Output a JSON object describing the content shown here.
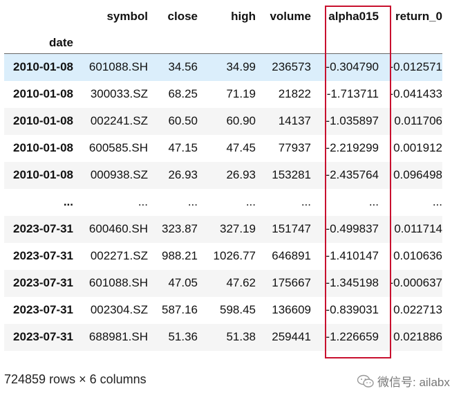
{
  "table": {
    "columns": [
      "symbol",
      "close",
      "high",
      "volume",
      "alpha015",
      "return_0"
    ],
    "index_name": "date",
    "rows": [
      {
        "date": "2010-01-08",
        "symbol": "601088.SH",
        "close": "34.56",
        "high": "34.99",
        "volume": "236573",
        "alpha015": "-0.304790",
        "return_0": "-0.012571"
      },
      {
        "date": "2010-01-08",
        "symbol": "300033.SZ",
        "close": "68.25",
        "high": "71.19",
        "volume": "21822",
        "alpha015": "-1.713711",
        "return_0": "-0.041433"
      },
      {
        "date": "2010-01-08",
        "symbol": "002241.SZ",
        "close": "60.50",
        "high": "60.90",
        "volume": "14137",
        "alpha015": "-1.035897",
        "return_0": "0.011706"
      },
      {
        "date": "2010-01-08",
        "symbol": "600585.SH",
        "close": "47.15",
        "high": "47.45",
        "volume": "77937",
        "alpha015": "-2.219299",
        "return_0": "0.001912"
      },
      {
        "date": "2010-01-08",
        "symbol": "000938.SZ",
        "close": "26.93",
        "high": "26.93",
        "volume": "153281",
        "alpha015": "-2.435764",
        "return_0": "0.096498"
      },
      {
        "date": "...",
        "symbol": "...",
        "close": "...",
        "high": "...",
        "volume": "...",
        "alpha015": "...",
        "return_0": "..."
      },
      {
        "date": "2023-07-31",
        "symbol": "600460.SH",
        "close": "323.87",
        "high": "327.19",
        "volume": "151747",
        "alpha015": "-0.499837",
        "return_0": "0.011714"
      },
      {
        "date": "2023-07-31",
        "symbol": "002271.SZ",
        "close": "988.21",
        "high": "1026.77",
        "volume": "646891",
        "alpha015": "-1.410147",
        "return_0": "0.010636"
      },
      {
        "date": "2023-07-31",
        "symbol": "601088.SH",
        "close": "47.05",
        "high": "47.62",
        "volume": "175667",
        "alpha015": "-1.345198",
        "return_0": "-0.000637"
      },
      {
        "date": "2023-07-31",
        "symbol": "002304.SZ",
        "close": "587.16",
        "high": "598.45",
        "volume": "136609",
        "alpha015": "-0.839031",
        "return_0": "0.022713"
      },
      {
        "date": "2023-07-31",
        "symbol": "688981.SH",
        "close": "51.36",
        "high": "51.38",
        "volume": "259441",
        "alpha015": "-1.226659",
        "return_0": "0.021886"
      }
    ]
  },
  "shape_text": "724859 rows × 6 columns",
  "watermark": {
    "text": "微信号: ailabx",
    "icon": "wechat-icon"
  },
  "colors": {
    "highlight_row": "#dbeefb",
    "striped_row": "#f5f5f5",
    "annotation_box": "#c8102e"
  }
}
